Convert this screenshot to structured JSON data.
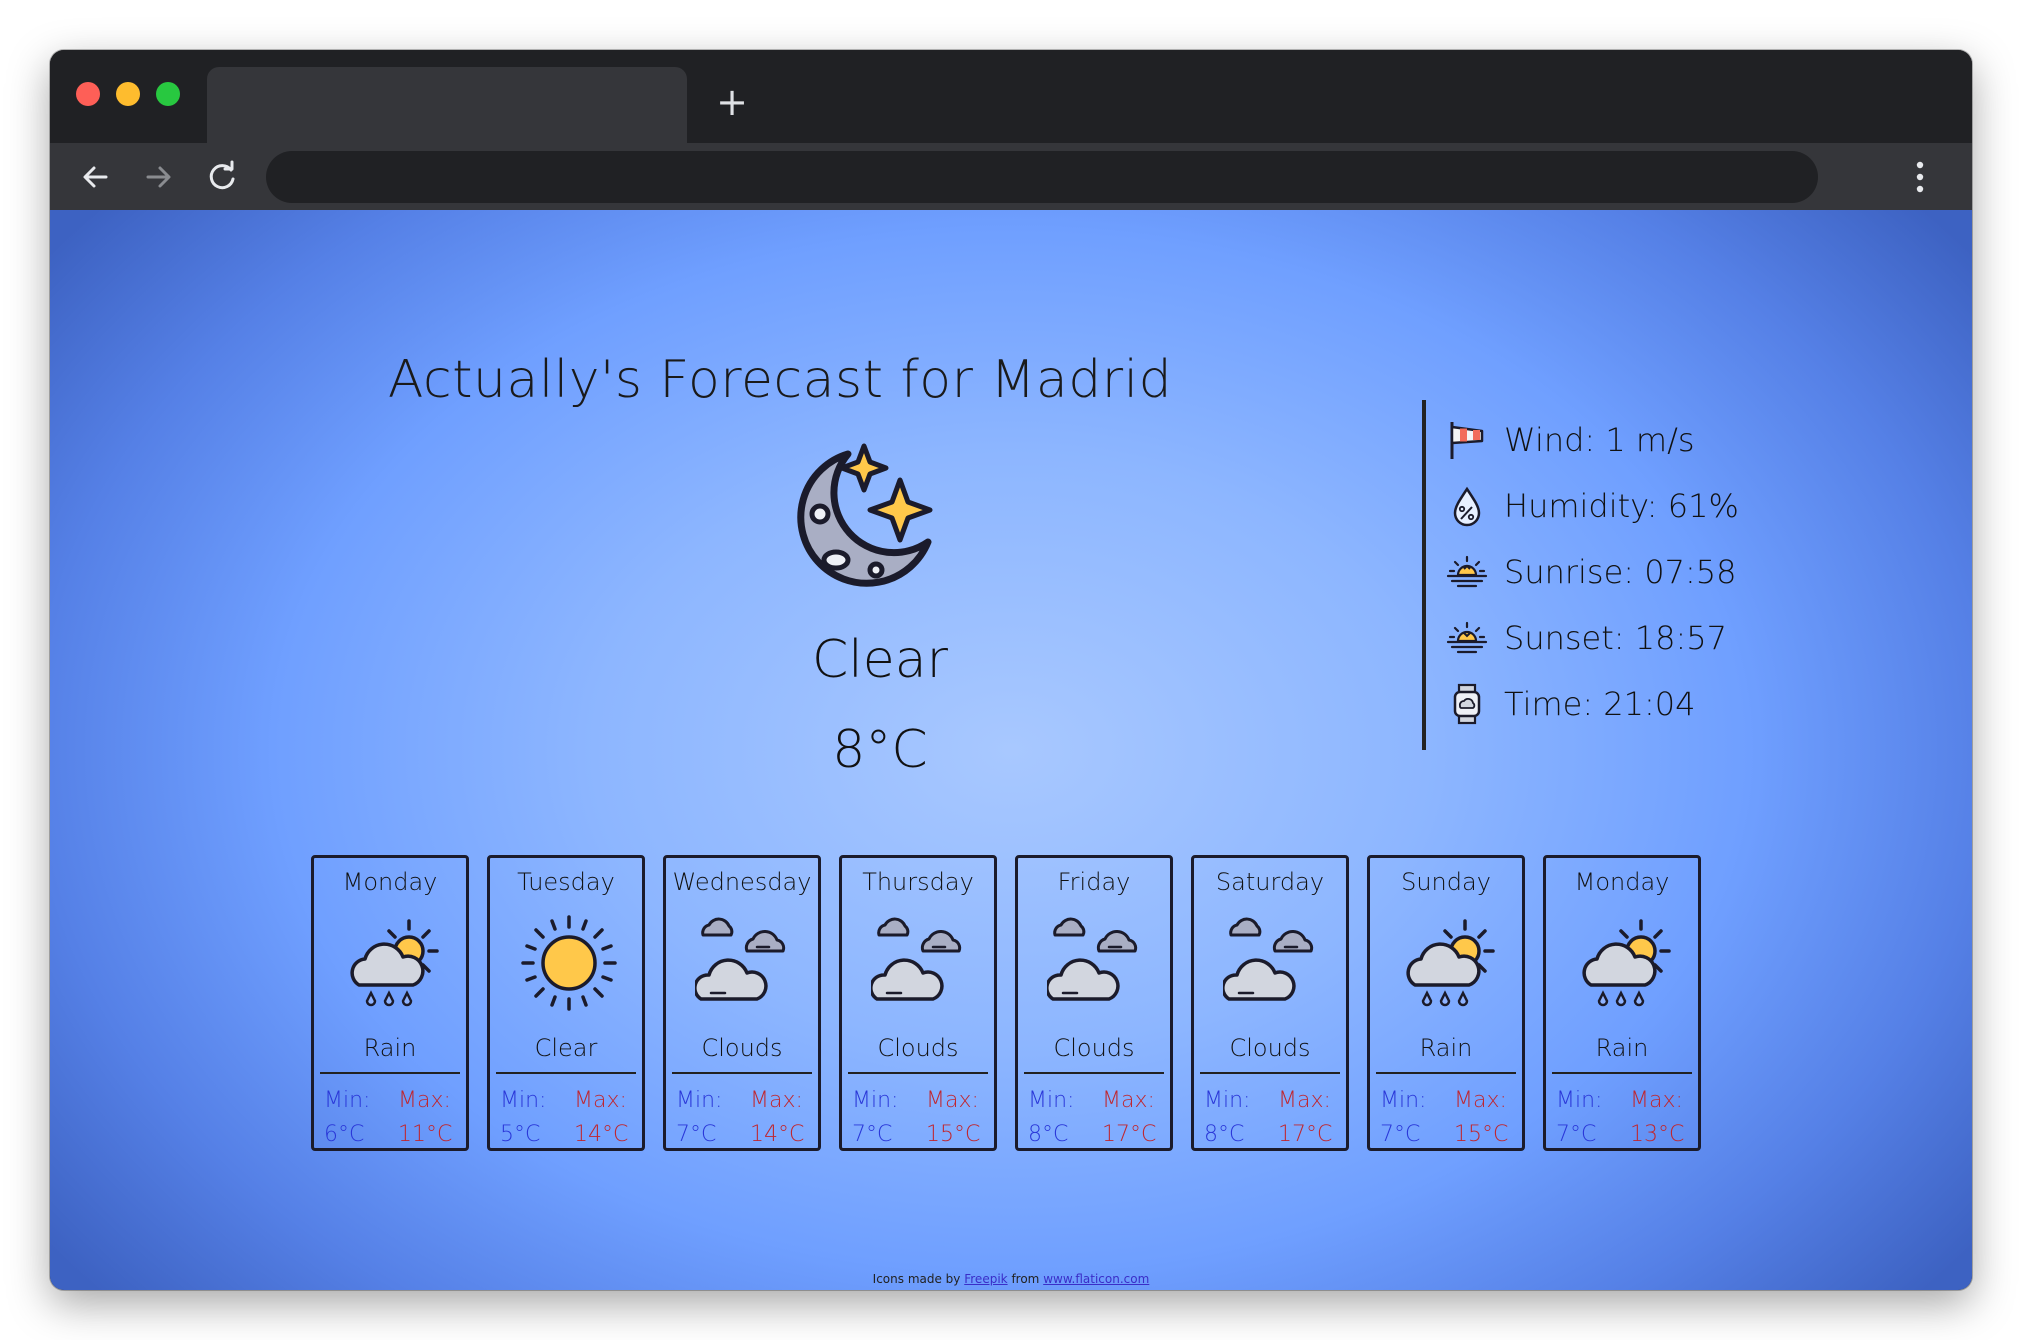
{
  "page": {
    "title": "Actually's Forecast for Madrid",
    "current": {
      "icon": "moon-stars-icon",
      "condition": "Clear",
      "temperature": "8°C"
    },
    "details": [
      {
        "icon": "windsock-icon",
        "text": "Wind: 1 m/s"
      },
      {
        "icon": "humidity-drop-icon",
        "text": "Humidity: 61%"
      },
      {
        "icon": "sunrise-icon",
        "text": "Sunrise: 07:58"
      },
      {
        "icon": "sunset-icon",
        "text": "Sunset: 18:57"
      },
      {
        "icon": "watch-icon",
        "text": "Time: 21:04"
      }
    ],
    "forecast": [
      {
        "day": "Monday",
        "icon": "sun-cloud-rain-icon",
        "condition": "Rain",
        "min_label": "Min:",
        "max_label": "Max:",
        "min": "6°C",
        "max": "11°C"
      },
      {
        "day": "Tuesday",
        "icon": "sun-icon",
        "condition": "Clear",
        "min_label": "Min:",
        "max_label": "Max:",
        "min": "5°C",
        "max": "14°C"
      },
      {
        "day": "Wednesday",
        "icon": "clouds-icon",
        "condition": "Clouds",
        "min_label": "Min:",
        "max_label": "Max:",
        "min": "7°C",
        "max": "14°C"
      },
      {
        "day": "Thursday",
        "icon": "clouds-icon",
        "condition": "Clouds",
        "min_label": "Min:",
        "max_label": "Max:",
        "min": "7°C",
        "max": "15°C"
      },
      {
        "day": "Friday",
        "icon": "clouds-icon",
        "condition": "Clouds",
        "min_label": "Min:",
        "max_label": "Max:",
        "min": "8°C",
        "max": "17°C"
      },
      {
        "day": "Saturday",
        "icon": "clouds-icon",
        "condition": "Clouds",
        "min_label": "Min:",
        "max_label": "Max:",
        "min": "8°C",
        "max": "17°C"
      },
      {
        "day": "Sunday",
        "icon": "sun-cloud-rain-icon",
        "condition": "Rain",
        "min_label": "Min:",
        "max_label": "Max:",
        "min": "7°C",
        "max": "15°C"
      },
      {
        "day": "Monday",
        "icon": "sun-cloud-rain-icon",
        "condition": "Rain",
        "min_label": "Min:",
        "max_label": "Max:",
        "min": "7°C",
        "max": "13°C"
      }
    ],
    "footer": {
      "prefix": "Icons made by",
      "link1": "Freepik",
      "middle": "from",
      "link2": "www.flaticon.com"
    }
  },
  "browser": {
    "new_tab_glyph": "+"
  },
  "colors": {
    "min": "#2a37d8",
    "max": "#c0262e",
    "sun": "#ffc84a",
    "cloud": "#d2d6df",
    "moon": "#a9aec4"
  }
}
